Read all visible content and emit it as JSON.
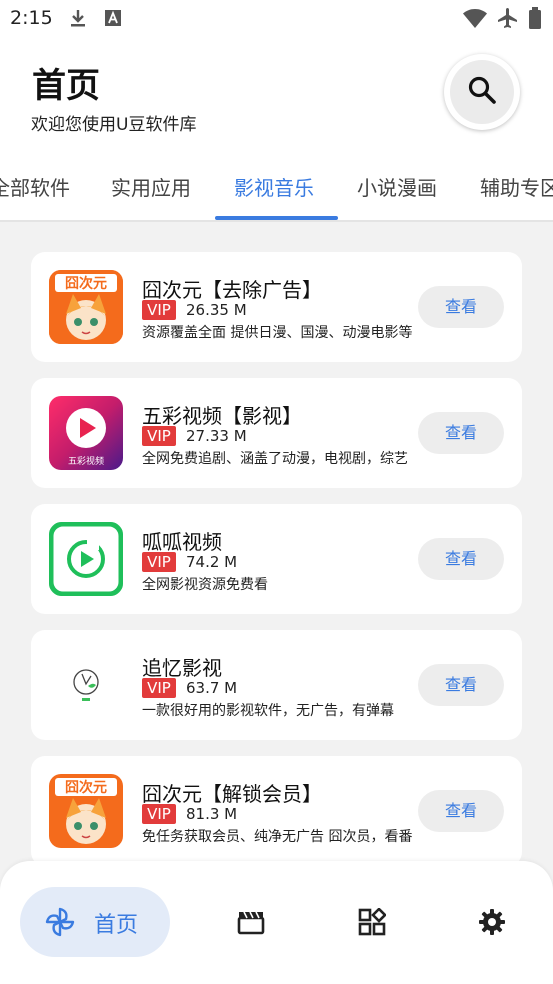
{
  "status_bar": {
    "time": "2:15"
  },
  "header": {
    "title": "首页",
    "subtitle": "欢迎您使用U豆软件库"
  },
  "tabs": [
    {
      "label": "全部软件"
    },
    {
      "label": "实用应用"
    },
    {
      "label": "影视音乐"
    },
    {
      "label": "小说漫画"
    },
    {
      "label": "辅助专区"
    }
  ],
  "apps": [
    {
      "name": "囧次元【去除广告】",
      "badge": "VIP",
      "size": "26.35 M",
      "desc": "资源覆盖全面 提供日漫、国漫、动漫电影等",
      "button": "查看",
      "icon_text": "囧次元"
    },
    {
      "name": "五彩视频【影视】",
      "badge": "VIP",
      "size": "27.33 M",
      "desc": "全网免费追剧、涵盖了动漫，电视剧，综艺",
      "button": "查看",
      "icon_text": "五彩视频"
    },
    {
      "name": "呱呱视频",
      "badge": "VIP",
      "size": "74.2 M",
      "desc": "全网影视资源免费看",
      "button": "查看"
    },
    {
      "name": "追忆影视",
      "badge": "VIP",
      "size": "63.7 M",
      "desc": "一款很好用的影视软件，无广告，有弹幕",
      "button": "查看"
    },
    {
      "name": "囧次元【解锁会员】",
      "badge": "VIP",
      "size": "81.3 M",
      "desc": "免任务获取会员、纯净无广告 囧次员，看番",
      "button": "查看",
      "icon_text": "囧次元"
    }
  ],
  "bottom_nav": {
    "home_label": "首页"
  },
  "colors": {
    "accent": "#3a7be0",
    "vip": "#e23b3b",
    "background": "#f2f2f2"
  },
  "icons": [
    "download-icon",
    "font-icon",
    "wifi-icon",
    "airplane-icon",
    "search-icon",
    "pinwheel-icon",
    "clapperboard-icon",
    "apps-icon",
    "gear-icon"
  ]
}
